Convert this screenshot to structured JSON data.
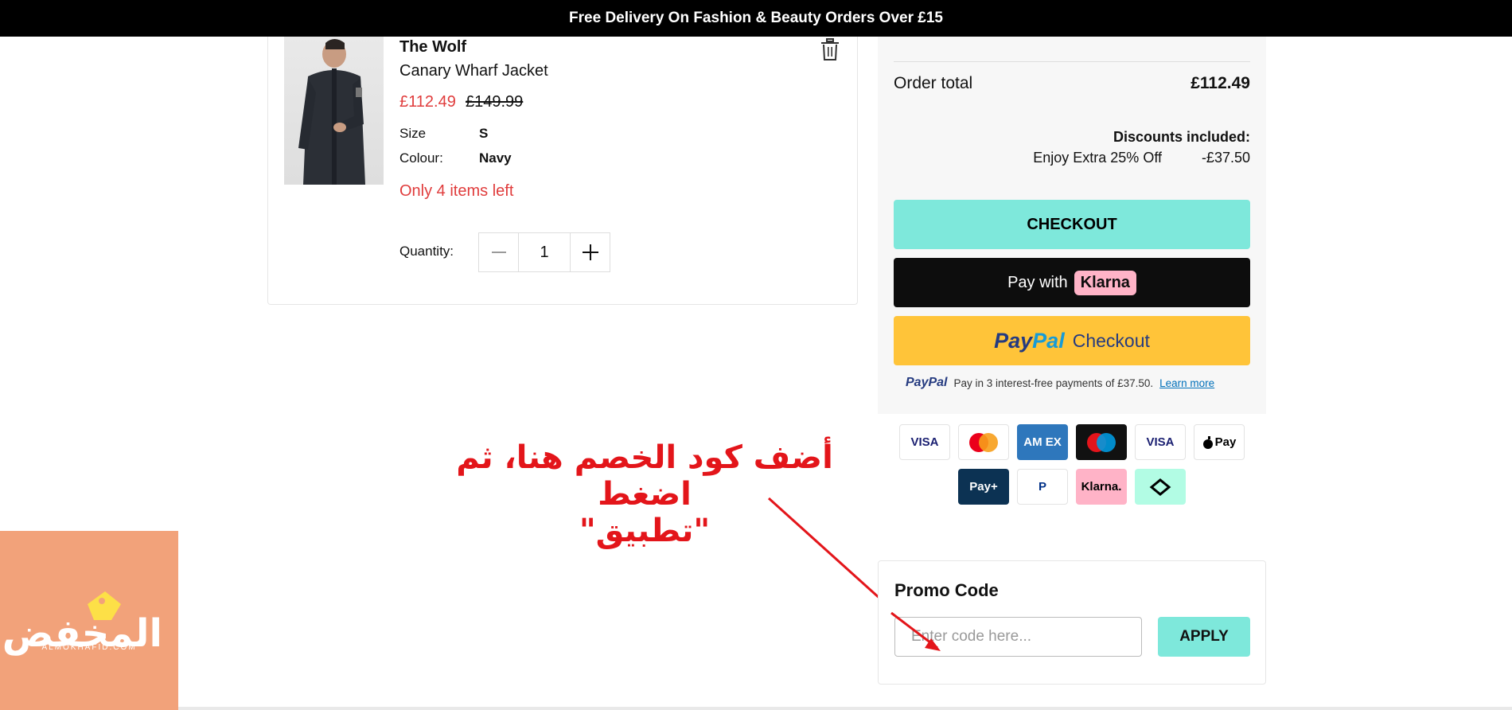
{
  "banner": {
    "text": "Free Delivery On Fashion & Beauty Orders Over £15"
  },
  "cart_item": {
    "brand": "The Wolf",
    "name": "Canary Wharf Jacket",
    "price_now": "£112.49",
    "price_was": "£149.99",
    "size_label": "Size",
    "size_value": "S",
    "colour_label": "Colour:",
    "colour_value": "Navy",
    "stock_text": "Only 4 items left",
    "quantity_label": "Quantity:",
    "quantity_value": "1",
    "icons": {
      "delete": "trash-icon",
      "minus": "minus-icon",
      "plus": "plus-icon"
    }
  },
  "summary": {
    "discount_label": "Discount",
    "discount_value": "-£37.50",
    "order_total_label": "Order total",
    "order_total_value": "£112.49",
    "discounts_included_label": "Discounts included:",
    "discount_name": "Enjoy Extra 25% Off",
    "discount_amount": "-£37.50",
    "checkout_label": "CHECKOUT",
    "klarna_prefix": "Pay with",
    "klarna_brand": "Klarna",
    "paypal_pay": "Pay",
    "paypal_pal": "Pal",
    "paypal_checkout": "Checkout",
    "paypal_note_logo": "PayPal",
    "paypal_note": "Pay in 3 interest-free payments of £37.50.",
    "paypal_learn_more": "Learn more"
  },
  "payment_methods": [
    {
      "name": "Visa",
      "label": "VISA",
      "bg": "#ffffff",
      "fg": "#1a1f71"
    },
    {
      "name": "Mastercard",
      "label": "",
      "bg": "#ffffff",
      "fg": "#eb001b"
    },
    {
      "name": "American Express",
      "label": "AM EX",
      "bg": "#2e77bc",
      "fg": "#ffffff"
    },
    {
      "name": "Maestro",
      "label": "",
      "bg": "#111111",
      "fg": "#ffffff"
    },
    {
      "name": "Visa Electron",
      "label": "VISA",
      "bg": "#ffffff",
      "fg": "#1a1f71"
    },
    {
      "name": "Apple Pay",
      "label": "Pay",
      "bg": "#ffffff",
      "fg": "#000000"
    },
    {
      "name": "Laybuy",
      "label": "Pay+",
      "bg": "#0c3253",
      "fg": "#ffffff"
    },
    {
      "name": "PayPal",
      "label": "P",
      "bg": "#ffffff",
      "fg": "#003087"
    },
    {
      "name": "Klarna",
      "label": "Klarna.",
      "bg": "#ffb3c7",
      "fg": "#000000"
    },
    {
      "name": "Clearpay",
      "label": "",
      "bg": "#b2fce4",
      "fg": "#000000"
    }
  ],
  "annotation": {
    "line1": "أضف كود الخصم هنا، ثم اضغط",
    "line2": "\"تطبيق\"",
    "color": "#e3151a"
  },
  "promo": {
    "title": "Promo Code",
    "placeholder": "Enter code here...",
    "apply_label": "APPLY"
  },
  "watermark": {
    "logo_text": "المخفض",
    "logo_sub": "ALMOKHAFID.COM",
    "bg": "#f2a27a"
  },
  "colors": {
    "accent": "#7ee8db",
    "sale": "#e03c3c",
    "klarna_pink": "#ffb3c7",
    "paypal_yellow": "#ffc439"
  }
}
